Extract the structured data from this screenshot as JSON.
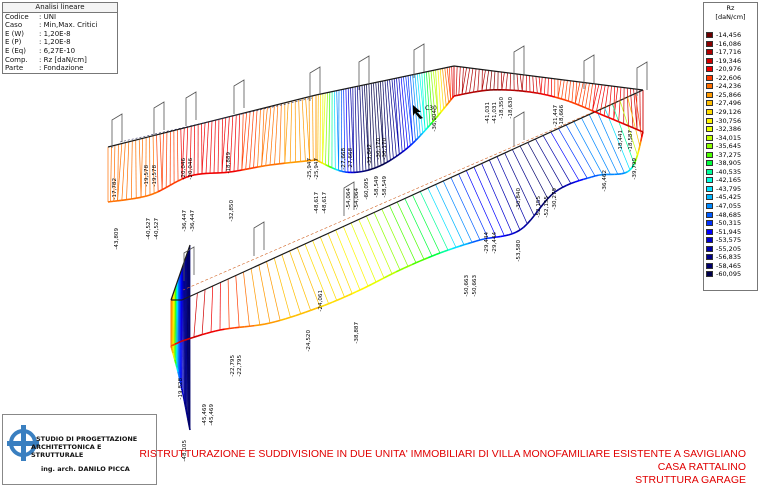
{
  "info_panel": {
    "title": "Analisi lineare",
    "rows": [
      {
        "key": "Codice",
        "value": ": UNI"
      },
      {
        "key": "Caso",
        "value": ": Min,Max. Critici"
      },
      {
        "key": "E (W)",
        "value": ": 1,20E-8"
      },
      {
        "key": "E (P)",
        "value": ": 1,20E-8"
      },
      {
        "key": "E (Eq)",
        "value": ": 6,27E-10"
      },
      {
        "key": "Comp.",
        "value": ": Rz [daN/cm]"
      },
      {
        "key": "Parte",
        "value": ": Fondazione"
      }
    ]
  },
  "legend": {
    "title": "Rz",
    "unit": "[daN/cm]",
    "items": [
      {
        "label": "-14,456",
        "color": "#6b0000"
      },
      {
        "label": "-16,086",
        "color": "#8a0000"
      },
      {
        "label": "-17,716",
        "color": "#b00000"
      },
      {
        "label": "-19,346",
        "color": "#d00000"
      },
      {
        "label": "-20,976",
        "color": "#f00000"
      },
      {
        "label": "-22,606",
        "color": "#ff3c00"
      },
      {
        "label": "-24,236",
        "color": "#ff7000"
      },
      {
        "label": "-25,866",
        "color": "#ff9a00"
      },
      {
        "label": "-27,496",
        "color": "#ffbe00"
      },
      {
        "label": "-29,126",
        "color": "#ffdc00"
      },
      {
        "label": "-30,756",
        "color": "#fff400"
      },
      {
        "label": "-32,386",
        "color": "#e6ff00"
      },
      {
        "label": "-34,015",
        "color": "#bfff00"
      },
      {
        "label": "-35,645",
        "color": "#8cff00"
      },
      {
        "label": "-37,275",
        "color": "#4cff00"
      },
      {
        "label": "-38,905",
        "color": "#00ff3c"
      },
      {
        "label": "-40,535",
        "color": "#00ff9a"
      },
      {
        "label": "-42,165",
        "color": "#00ffe0"
      },
      {
        "label": "-43,795",
        "color": "#00e0ff"
      },
      {
        "label": "-45,425",
        "color": "#00b4ff"
      },
      {
        "label": "-47,055",
        "color": "#0088ff"
      },
      {
        "label": "-48,685",
        "color": "#005cff"
      },
      {
        "label": "-50,315",
        "color": "#0030ff"
      },
      {
        "label": "-51,945",
        "color": "#0000ff"
      },
      {
        "label": "-53,575",
        "color": "#0000d0"
      },
      {
        "label": "-55,205",
        "color": "#0000a8"
      },
      {
        "label": "-56,835",
        "color": "#000088"
      },
      {
        "label": "-58,465",
        "color": "#00006a"
      },
      {
        "label": "-60,095",
        "color": "#00004c"
      }
    ]
  },
  "logo": {
    "line1": "STUDIO DI PROGETTAZIONE",
    "line2": "ARCHITETTONICA E STRUTTURALE",
    "line3": "ing. arch. DANILO PICCA"
  },
  "project": {
    "title": "RISTRUTTURAZIONE E SUDDIVISIONE IN DUE UNITA' IMMOBILIARI DI VILLA MONOFAMILIARE ESISTENTE A SAVIGLIANO",
    "subtitle1": "CASA RATTALINO",
    "subtitle2": "STRUTTURA GARAGE"
  },
  "value_labels": [
    "-17,782",
    "-19,578",
    "-19,578",
    "-20,046",
    "-20,046",
    "-18,889",
    "-25,947",
    "-25,947",
    "-27,668",
    "-27,668",
    "-33,642",
    "-30,170",
    "-30,170",
    "-36,904",
    "-41,031",
    "-41,031",
    "-18,350",
    "-18,630",
    "-21,447",
    "-18,666",
    "-18,441",
    "-18,587",
    "-43,809",
    "-40,527",
    "-40,527",
    "-36,447",
    "-36,447",
    "-32,850",
    "-48,617",
    "-48,617",
    "-54,064",
    "-54,064",
    "-60,095",
    "-58,549",
    "-58,549",
    "-30,840",
    "-52,155",
    "-52,155",
    "-30,279",
    "-36,462",
    "-39,799",
    "-53,580",
    "-29,444",
    "-29,444",
    "-50,663",
    "-50,663",
    "-24,061",
    "-24,520",
    "-38,887",
    "-22,795",
    "-22,795",
    "-19,828",
    "-45,469",
    "-45,469",
    "-48,105"
  ],
  "node_label": "C30"
}
